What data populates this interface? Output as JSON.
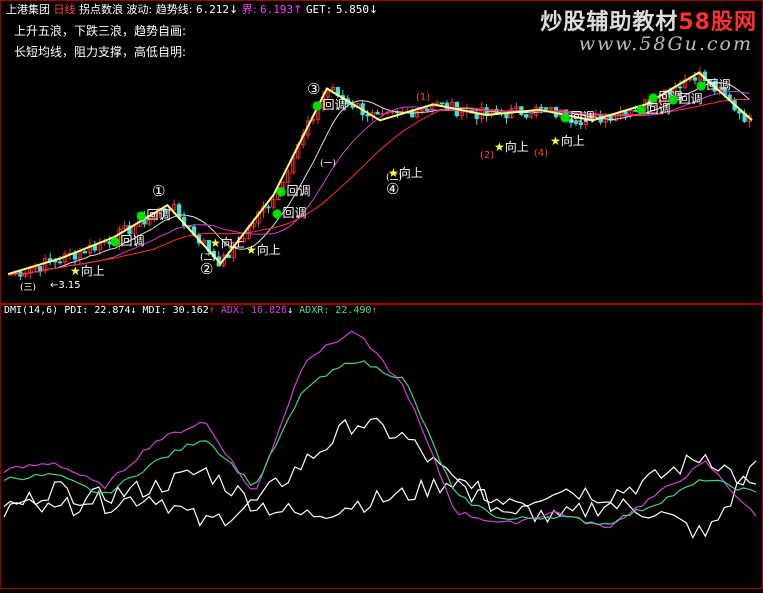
{
  "header": {
    "stock_name": "上港集团",
    "period": "日线",
    "indicator_name": "拐点数浪",
    "wave_label": "波动:",
    "trend_label": "趋势线:",
    "trend_value": "6.212",
    "trend_arrow": "↓",
    "boundary_label": "界:",
    "boundary_value": "6.193",
    "boundary_arrow": "↑",
    "get_label": "GET:",
    "get_value": "5.850",
    "get_arrow": "↓",
    "line2": "上升五浪，下跌三浪，趋势自画:",
    "line3": "长短均线，阻力支撑，高低自明:"
  },
  "watermark": {
    "line1_a": "炒股辅助教材",
    "line1_b": "58股网",
    "line2": "www.58Gu.com"
  },
  "price_panel": {
    "labels_up": [
      "向上",
      "向上",
      "向上",
      "向上",
      "向上",
      "向上"
    ],
    "labels_pullback": [
      "回调",
      "回调",
      "回调",
      "回调",
      "回调",
      "回调",
      "回调",
      "回调",
      "回调",
      "回调"
    ],
    "wave_numbers": [
      "①",
      "②",
      "③",
      "④"
    ],
    "sub_marks": [
      "(三)",
      "(二)",
      "(一)",
      "(二)",
      "(1)",
      "(2)",
      "(4)"
    ],
    "low_value_label": "3.15"
  },
  "dmi_panel": {
    "title": "DMI(14,6)",
    "pdi_label": "PDI:",
    "pdi_value": "22.874",
    "pdi_arrow": "↓",
    "mdi_label": "MDI:",
    "mdi_value": "30.162",
    "mdi_arrow": "↑",
    "adx_label": "ADX:",
    "adx_value": "16.826",
    "adx_arrow": "↓",
    "adxr_label": "ADXR:",
    "adxr_value": "22.490",
    "adxr_arrow": "↑"
  },
  "colors": {
    "background": "#000000",
    "panel_border": "#a00000",
    "rise": "#ff3030",
    "fall": "#40e0e0",
    "trend_yellow": "#ffff80",
    "pullback_green": "#00e000",
    "star_yellow": "#ffff40",
    "pdi": "#ffffff",
    "mdi": "#ffffff",
    "adx": "#d040d0",
    "adxr": "#40d090"
  },
  "chart_data": [
    {
      "type": "line",
      "series": [
        {
          "name": "趋势线",
          "values": [
            3.3,
            3.6,
            4.0,
            4.6,
            3.5,
            4.8,
            6.8,
            6.2,
            6.5,
            6.3,
            6.4,
            6.2,
            6.5,
            7.1,
            6.2
          ]
        }
      ],
      "x": [
        1,
        2,
        3,
        4,
        5,
        6,
        7,
        8,
        9,
        10,
        11,
        12,
        13,
        14,
        15
      ]
    },
    {
      "type": "line",
      "series": [
        {
          "name": "PDI",
          "values": [
            18,
            24,
            20,
            22,
            15,
            20,
            30,
            40,
            36,
            25,
            18,
            24,
            22,
            26,
            32,
            22.874
          ]
        },
        {
          "name": "MDI",
          "values": [
            20,
            18,
            22,
            24,
            28,
            20,
            17,
            20,
            22,
            26,
            20,
            16,
            20,
            18,
            12,
            30.162
          ]
        },
        {
          "name": "ADX",
          "values": [
            28,
            30,
            24,
            35,
            40,
            22,
            55,
            62,
            48,
            18,
            15,
            18,
            14,
            22,
            30,
            16.826
          ]
        },
        {
          "name": "ADXR",
          "values": [
            26,
            27,
            22,
            30,
            36,
            24,
            48,
            55,
            50,
            22,
            16,
            17,
            15,
            20,
            26,
            22.49
          ]
        }
      ],
      "x": [
        1,
        2,
        3,
        4,
        5,
        6,
        7,
        8,
        9,
        10,
        11,
        12,
        13,
        14,
        15,
        16
      ]
    }
  ]
}
